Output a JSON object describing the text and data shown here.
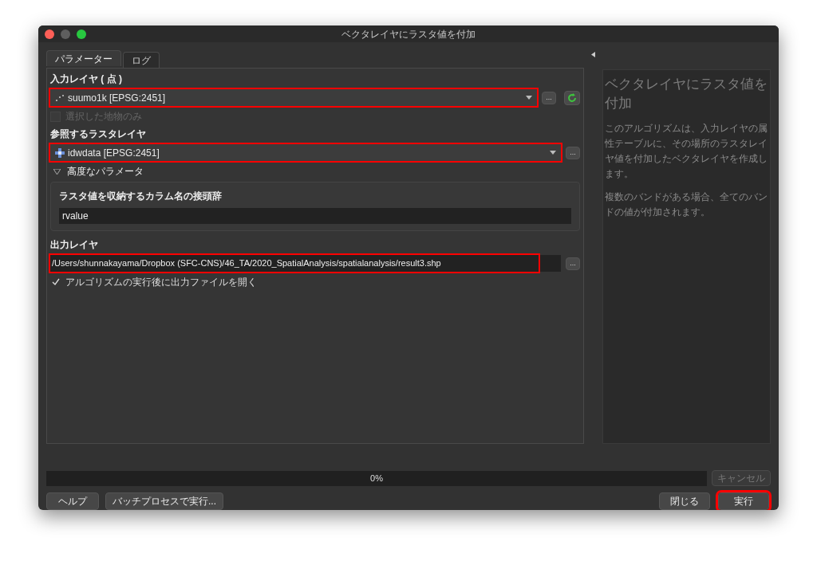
{
  "window": {
    "title": "ベクタレイヤにラスタ値を付加"
  },
  "tabs": [
    {
      "label": "パラメーター",
      "selected": true
    },
    {
      "label": "ログ",
      "selected": false
    }
  ],
  "input_layer": {
    "label": "入力レイヤ ( 点 )",
    "value": "suumo1k [EPSG:2451]",
    "browse": "...",
    "highlighted": true
  },
  "selected_only": {
    "label": "選択した地物のみ",
    "checked": false,
    "disabled": true
  },
  "raster_layer": {
    "label": "参照するラスタレイヤ",
    "value": "idwdata [EPSG:2451]",
    "browse": "...",
    "highlighted": true
  },
  "advanced": {
    "label": "高度なパラメータ",
    "expanded": true,
    "field": {
      "label": "ラスタ値を収納するカラム名の接頭辞",
      "value": "rvalue"
    }
  },
  "output_layer": {
    "label": "出力レイヤ",
    "value": "/Users/shunnakayama/Dropbox (SFC-CNS)/46_TA/2020_SpatialAnalysis/spatialanalysis/result3.shp",
    "browse": "...",
    "highlighted": true
  },
  "open_output": {
    "label": "アルゴリズムの実行後に出力ファイルを開く",
    "checked": true,
    "disabled": false
  },
  "help": {
    "title": "ベクタレイヤにラスタ値を付加",
    "paragraphs": [
      "このアルゴリズムは、入力レイヤの属性テーブルに、その場所のラスタレイヤ値を付加したベクタレイヤを作成します。",
      "複数のバンドがある場合、全てのバンドの値が付加されます。"
    ]
  },
  "progress": {
    "level": 0,
    "reading": "0%"
  },
  "cancel": {
    "label": "キャンセル",
    "disabled": true
  },
  "left_buttons": [
    {
      "label": "ヘルプ",
      "highlighted": false
    },
    {
      "label": "バッチプロセスで実行...",
      "highlighted": false
    }
  ],
  "right_buttons": [
    {
      "label": "閉じる",
      "highlighted": false
    },
    {
      "label": "実行",
      "highlighted": true
    }
  ]
}
